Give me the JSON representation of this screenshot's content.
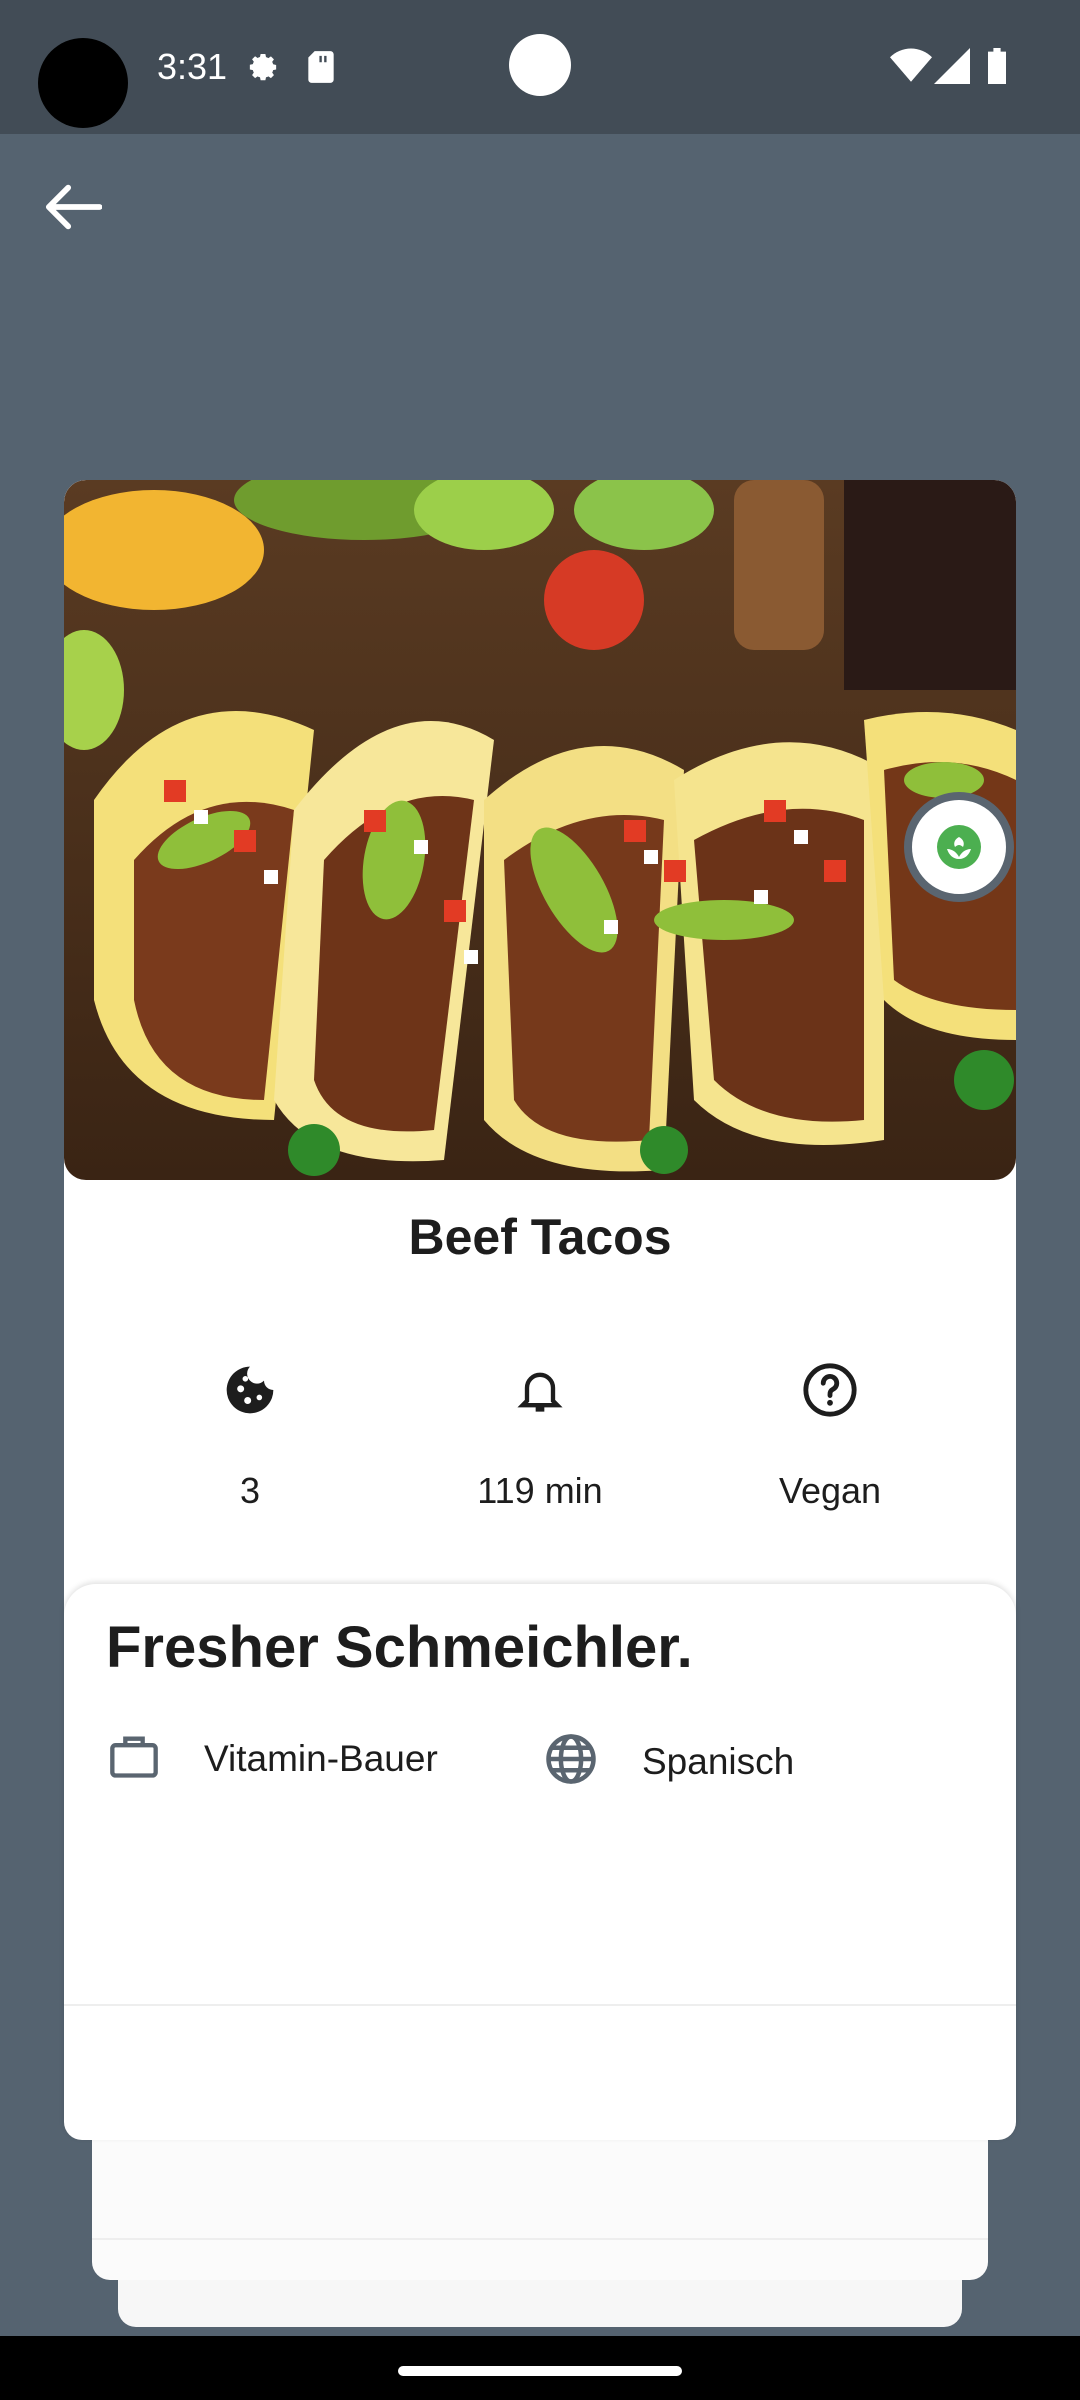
{
  "status_bar": {
    "time": "3:31",
    "icons": [
      "settings-icon",
      "sd-card-icon",
      "wifi-icon",
      "signal-icon",
      "battery-icon"
    ]
  },
  "recipe": {
    "title": "Beef Tacos",
    "image_alt": "beef-tacos-photo",
    "badge_icon": "vegan-leaf-icon",
    "stats": [
      {
        "icon": "cookie-icon",
        "value": "3"
      },
      {
        "icon": "bell-icon",
        "value": "119 min"
      },
      {
        "icon": "help-circle-icon",
        "value": "Vegan"
      }
    ]
  },
  "info": {
    "tagline": "Fresher Schmeichler.",
    "category_icon": "briefcase-icon",
    "category": "Vitamin-Bauer",
    "cuisine_icon": "globe-icon",
    "cuisine": "Spanisch"
  },
  "colors": {
    "background": "#556370",
    "status_bar": "#424c56",
    "card": "#ffffff",
    "text": "#1d1d1d",
    "badge_green": "#4caf50"
  }
}
